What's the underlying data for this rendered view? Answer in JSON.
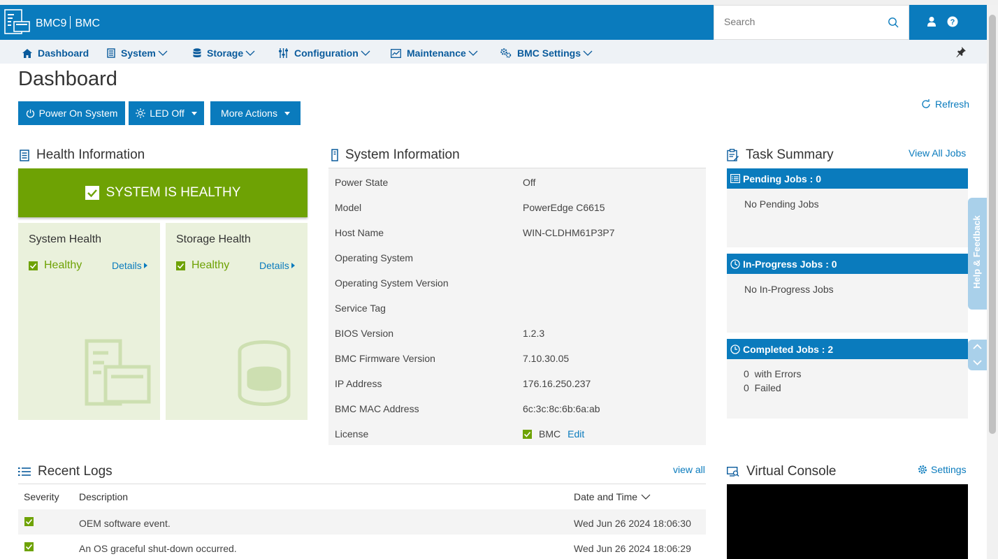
{
  "header": {
    "app_name": "BMC9",
    "app_subtitle": "BMC",
    "search_placeholder": "Search"
  },
  "nav": [
    {
      "label": "Dashboard",
      "icon": "home-icon"
    },
    {
      "label": "System",
      "icon": "server-icon"
    },
    {
      "label": "Storage",
      "icon": "database-icon"
    },
    {
      "label": "Configuration",
      "icon": "sliders-icon"
    },
    {
      "label": "Maintenance",
      "icon": "monitor-chart-icon"
    },
    {
      "label": "BMC Settings",
      "icon": "gears-icon"
    }
  ],
  "page": {
    "title": "Dashboard",
    "refresh_label": "Refresh"
  },
  "actions": {
    "power_on": "Power On System",
    "led_off": "LED Off",
    "more_actions": "More Actions"
  },
  "health": {
    "title": "Health Information",
    "banner": "SYSTEM IS HEALTHY",
    "system": {
      "title": "System Health",
      "status": "Healthy",
      "details": "Details"
    },
    "storage": {
      "title": "Storage Health",
      "status": "Healthy",
      "details": "Details"
    },
    "accent_color": "#6ea204"
  },
  "system_info": {
    "title": "System Information",
    "rows": [
      {
        "label": "Power State",
        "value": "Off"
      },
      {
        "label": "Model",
        "value": "PowerEdge C6615"
      },
      {
        "label": "Host Name",
        "value": "WIN-CLDHM61P3P7"
      },
      {
        "label": "Operating System",
        "value": ""
      },
      {
        "label": "Operating System Version",
        "value": ""
      },
      {
        "label": "Service Tag",
        "value": ""
      },
      {
        "label": "BIOS Version",
        "value": "1.2.3"
      },
      {
        "label": "BMC Firmware Version",
        "value": "7.10.30.05"
      },
      {
        "label": "IP Address",
        "value": "176.16.250.237"
      },
      {
        "label": "BMC MAC Address",
        "value": "6c:3c:8c:6b:6a:ab"
      }
    ],
    "license": {
      "label": "License",
      "value": "BMC",
      "edit": "Edit"
    }
  },
  "tasks": {
    "title": "Task Summary",
    "view_all": "View All Jobs",
    "pending": {
      "header": "Pending Jobs : 0",
      "body": "No Pending Jobs"
    },
    "in_progress": {
      "header": "In-Progress Jobs : 0",
      "body": "No In-Progress Jobs"
    },
    "completed": {
      "header": "Completed Jobs : 2",
      "errors_count": "0",
      "errors_label": "with Errors",
      "failed_count": "0",
      "failed_label": "Failed"
    }
  },
  "help_feedback": "Help & Feedback",
  "logs": {
    "title": "Recent Logs",
    "view_all": "view all",
    "columns": {
      "severity": "Severity",
      "description": "Description",
      "datetime": "Date and Time"
    },
    "rows": [
      {
        "description": "OEM software event.",
        "datetime": "Wed Jun 26 2024 18:06:30"
      },
      {
        "description": "An OS graceful shut-down occurred.",
        "datetime": "Wed Jun 26 2024 18:06:29"
      }
    ]
  },
  "virtual_console": {
    "title": "Virtual Console",
    "settings": "Settings"
  },
  "colors": {
    "primary": "#0a7bbd",
    "healthy": "#6ea204"
  }
}
